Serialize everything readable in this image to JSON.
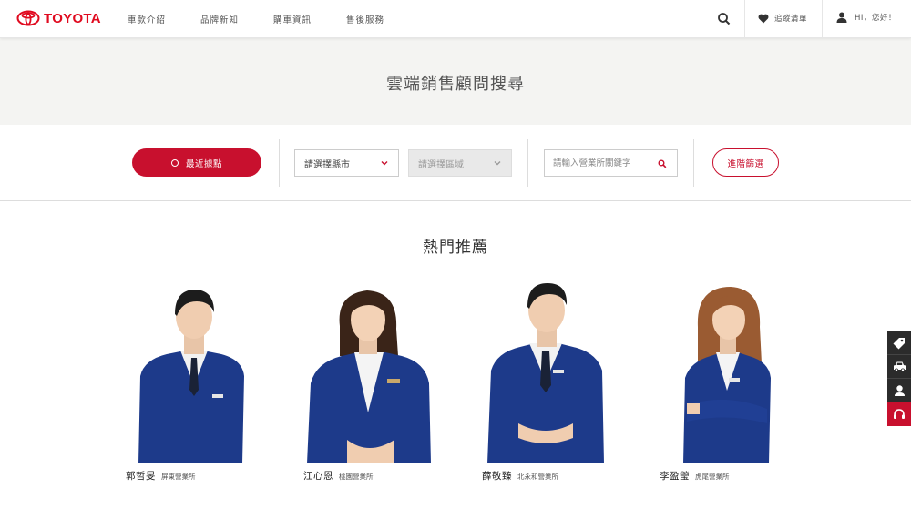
{
  "header": {
    "brand": "TOYOTA",
    "nav": [
      "車款介紹",
      "品牌新知",
      "購車資訊",
      "售後服務"
    ],
    "favorites_label": "追蹤清單",
    "user_greeting": "HI，您好！"
  },
  "hero": {
    "title": "雲端銷售顧問搜尋"
  },
  "filters": {
    "nearby_label": "最近據點",
    "city_select": "請選擇縣市",
    "district_select": "請選擇區域",
    "keyword_placeholder": "請輸入營業所關鍵字",
    "advanced_label": "進階篩選"
  },
  "recommend": {
    "title": "熱門推薦",
    "consultants": [
      {
        "name": "郭哲旻",
        "branch": "屏東營業所"
      },
      {
        "name": "江心恩",
        "branch": "桃園營業所"
      },
      {
        "name": "薛敬臻",
        "branch": "北永和營業所"
      },
      {
        "name": "李盈瑩",
        "branch": "虎尾營業所"
      }
    ]
  },
  "side_toolbar": [
    "tag-icon",
    "car-icon",
    "location-pin-icon",
    "headset-icon"
  ],
  "colors": {
    "brand_red": "#c8102e",
    "logo_red": "#e00a1f",
    "suit_navy": "#1d3a8a",
    "hero_bg": "#f4f4f2",
    "side_dark": "#2b2b2b"
  }
}
